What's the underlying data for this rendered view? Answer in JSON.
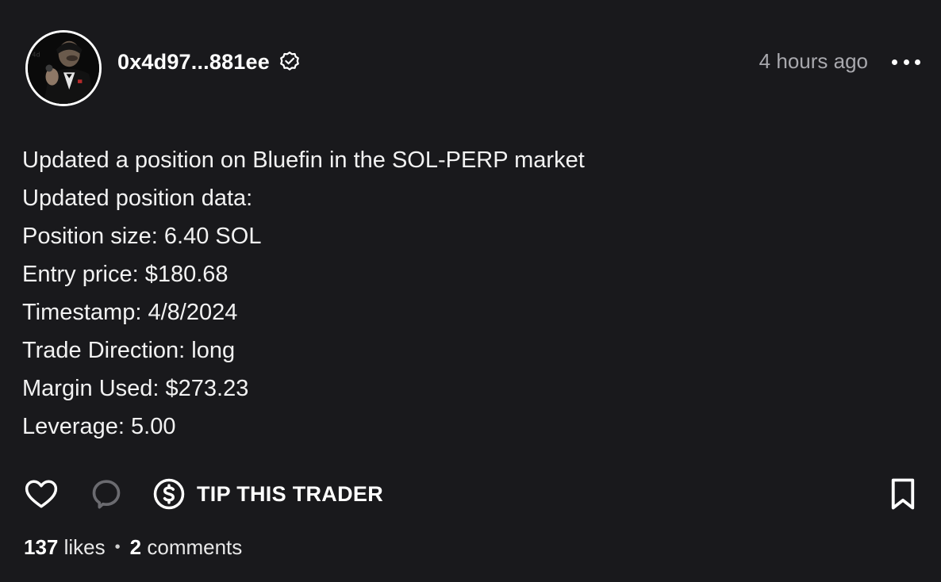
{
  "post": {
    "author": {
      "name": "0x4d97...881ee",
      "verified": true
    },
    "time": "4 hours ago",
    "lines": [
      "Updated a position on Bluefin in the SOL-PERP market",
      "Updated position data:",
      "Position size: 6.40 SOL",
      "Entry price: $180.68",
      "Timestamp: 4/8/2024",
      "Trade Direction: long",
      "Margin Used: $273.23",
      "Leverage: 5.00"
    ],
    "actions": {
      "tip_label": "TIP THIS TRADER"
    },
    "stats": {
      "likes_count": "137",
      "likes_label": "likes",
      "separator": "•",
      "comments_count": "2",
      "comments_label": "comments"
    }
  },
  "icons": {
    "like": "heart-icon",
    "comment": "comment-bubble-icon",
    "tip": "dollar-circle-icon",
    "bookmark": "bookmark-icon",
    "more": "more-horizontal-icon",
    "verified": "verified-badge-icon"
  },
  "colors": {
    "background": "#19191c",
    "text": "#ffffff",
    "muted": "#a8a8ad",
    "comment_icon": "#6b6b70"
  }
}
